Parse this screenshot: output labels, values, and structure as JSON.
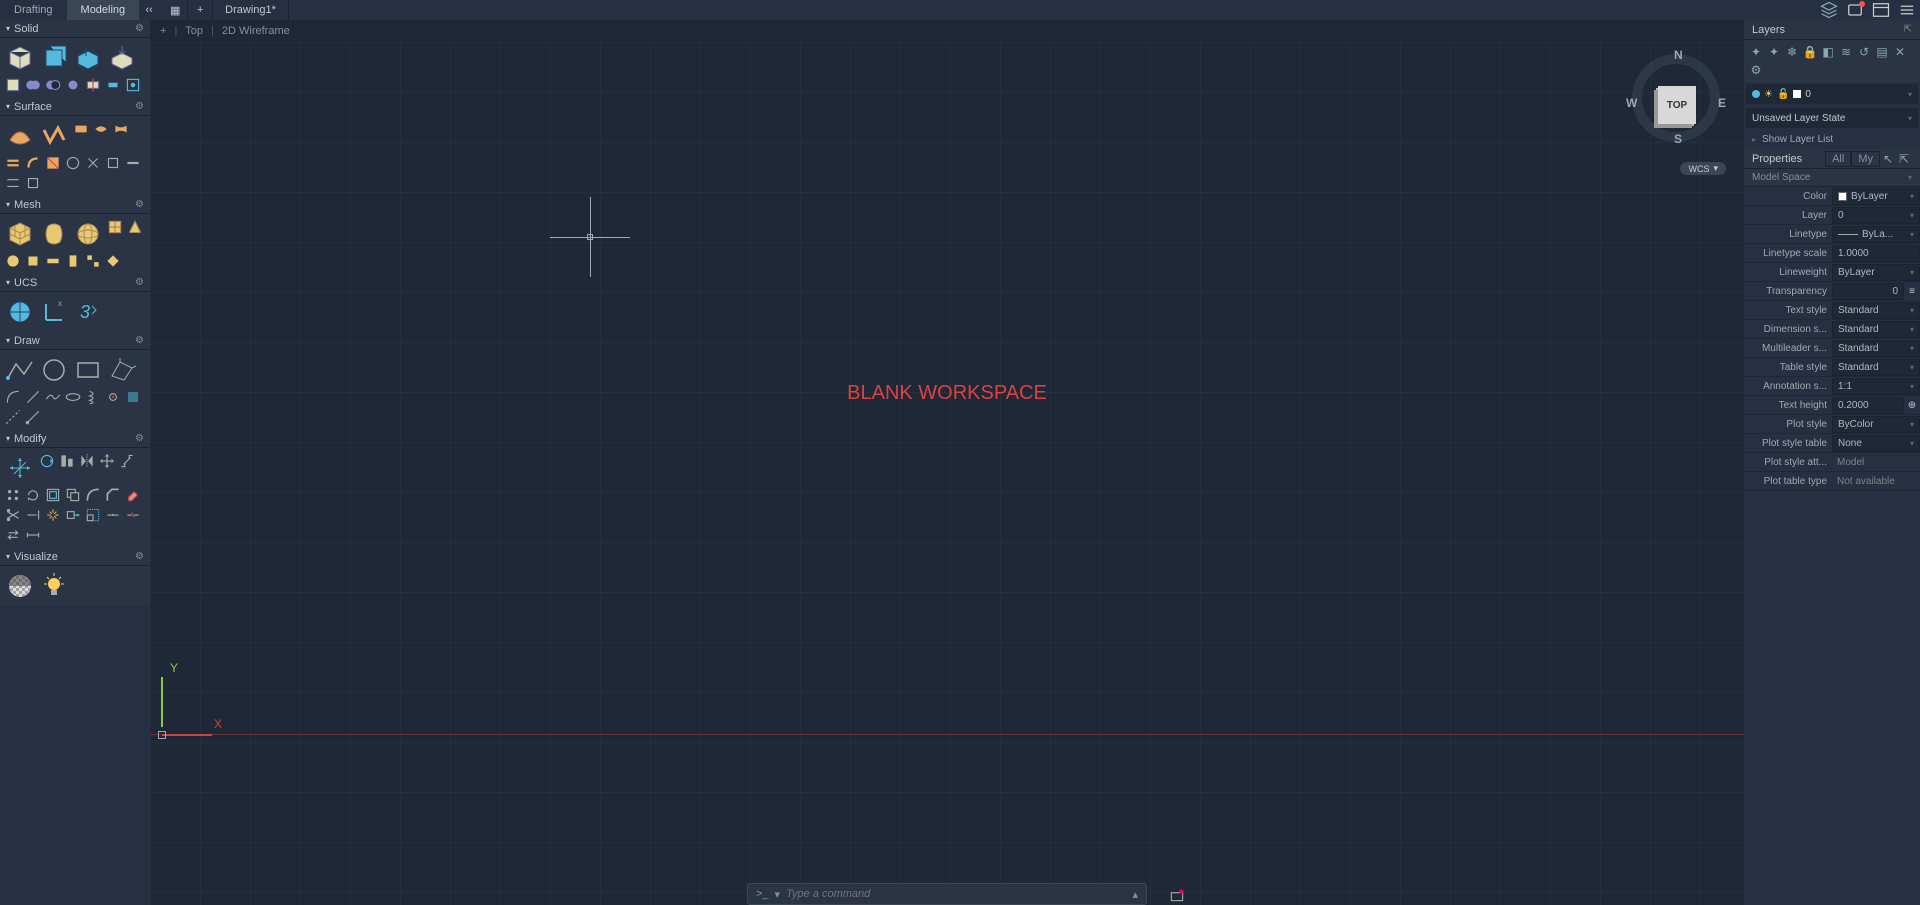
{
  "top_tabs": {
    "drafting": "Drafting",
    "modeling": "Modeling",
    "more": "‹‹"
  },
  "doc_tab": "Drawing1*",
  "workspace_header": {
    "plus": "+",
    "view": "Top",
    "style": "2D Wireframe"
  },
  "workspace_label": "BLANK WORKSPACE",
  "viewcube": {
    "face": "TOP",
    "n": "N",
    "s": "S",
    "e": "E",
    "w": "W"
  },
  "wcs_badge": "WCS",
  "ucs_axes": {
    "x": "X",
    "y": "Y"
  },
  "command_bar": {
    "prompt": ">_",
    "placeholder": "Type a command",
    "arrow": "▾"
  },
  "sections": {
    "solid": "Solid",
    "surface": "Surface",
    "mesh": "Mesh",
    "ucs": "UCS",
    "draw": "Draw",
    "modify": "Modify",
    "visualize": "Visualize"
  },
  "right": {
    "layers_title": "Layers",
    "current_layer": "0",
    "layer_state": "Unsaved Layer State",
    "show_filter": "Show Layer List",
    "properties_title": "Properties",
    "tabs": {
      "all": "All",
      "my": "My"
    },
    "model_space": "Model Space",
    "props": {
      "color": {
        "label": "Color",
        "value": "ByLayer"
      },
      "layer": {
        "label": "Layer",
        "value": "0"
      },
      "linetype": {
        "label": "Linetype",
        "value": "ByLa..."
      },
      "linetypescale": {
        "label": "Linetype scale",
        "value": "1.0000"
      },
      "lineweight": {
        "label": "Lineweight",
        "value": "ByLayer"
      },
      "transparency": {
        "label": "Transparency",
        "value": "0"
      },
      "textstyle": {
        "label": "Text style",
        "value": "Standard"
      },
      "dimstyle": {
        "label": "Dimension s...",
        "value": "Standard"
      },
      "mleader": {
        "label": "Multileader s...",
        "value": "Standard"
      },
      "tablestyle": {
        "label": "Table style",
        "value": "Standard"
      },
      "annoscale": {
        "label": "Annotation s...",
        "value": "1:1"
      },
      "textheight": {
        "label": "Text height",
        "value": "0.2000"
      },
      "plotstyle": {
        "label": "Plot style",
        "value": "ByColor"
      },
      "plotstyletable": {
        "label": "Plot style table",
        "value": "None"
      },
      "plotstyleatt": {
        "label": "Plot style att...",
        "value": "Model"
      },
      "plottabletype": {
        "label": "Plot table type",
        "value": "Not available"
      }
    }
  }
}
